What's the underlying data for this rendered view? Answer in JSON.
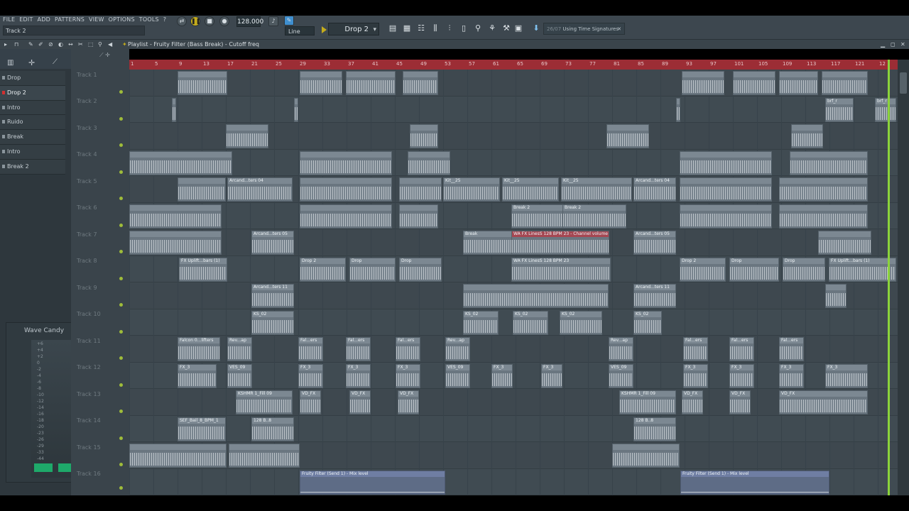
{
  "menu": [
    "FILE",
    "EDIT",
    "ADD",
    "PATTERNS",
    "VIEW",
    "OPTIONS",
    "TOOLS",
    "?"
  ],
  "hint": "Track 2",
  "tempo": "128.000",
  "snap_mode": "Line",
  "pattern": "Drop 2",
  "news": {
    "date": "26/07",
    "text": "Using Time Signatures"
  },
  "playlist_title": "Playlist - Fruity Filter (Bass Break) - Cutoff freq",
  "browser_items": [
    "Drop",
    "Drop 2",
    "Intro",
    "Ruido",
    "Break",
    "Intro",
    "Break 2"
  ],
  "wave_candy": {
    "title": "Wave Candy",
    "db_labels": [
      "+6",
      "+4",
      "+2",
      "0",
      "-2",
      "-4",
      "-6",
      "-8",
      "-10",
      "-12",
      "-14",
      "-16",
      "-18",
      "-20",
      "-23",
      "-26",
      "-29",
      "-33",
      "-44"
    ]
  },
  "tracks": [
    "Track 1",
    "Track 2",
    "Track 3",
    "Track 4",
    "Track 5",
    "Track 6",
    "Track 7",
    "Track 8",
    "Track 9",
    "Track 10",
    "Track 11",
    "Track 12",
    "Track 13",
    "Track 14",
    "Track 15",
    "Track 16"
  ],
  "ruler": [
    "1",
    "5",
    "9",
    "13",
    "17",
    "21",
    "25",
    "29",
    "33",
    "37",
    "41",
    "45",
    "49",
    "53",
    "57",
    "61",
    "65",
    "69",
    "73",
    "77",
    "81",
    "85",
    "89",
    "93",
    "97",
    "101",
    "105",
    "109",
    "113",
    "117",
    "121",
    "12"
  ],
  "clip_labels": {
    "brf": "brf_r",
    "kit": "Kit__25",
    "arcand04": "Arcand...ters 04",
    "arcand05": "Arcand...ters 05",
    "arcand11": "Arcand...ters 11",
    "break2": "Break 2",
    "break": "Break",
    "wafx": "WA FX LinesS 128 BPM 23 - Channel volume",
    "wafx2": "WA FX LinesS 128 BPM 23",
    "fxuplift": "FX Uplift...bars (1)",
    "drop2": "Drop 2",
    "drop": "Drop",
    "ks": "KS_02",
    "falcon": "Falcon 0...lifters",
    "revap": "Rev...ap",
    "fal": "Fal...ers",
    "fx3": "FX_3",
    "ves": "VES_09",
    "kshmr": "KSHMR 1_Fill 09",
    "vdfx": "VD_FX",
    "sef": "SEF_Bail_8_BPM_1",
    "bpm": "128 B..8",
    "filter": "Fruity Filter (Send 1) - Mix level"
  }
}
